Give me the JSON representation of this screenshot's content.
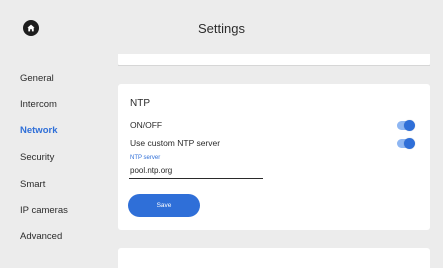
{
  "header": {
    "title": "Settings",
    "home_icon": "home-icon"
  },
  "sidebar": {
    "items": [
      {
        "label": "General"
      },
      {
        "label": "Intercom"
      },
      {
        "label": "Network",
        "active": true
      },
      {
        "label": "Security"
      },
      {
        "label": "Smart"
      },
      {
        "label": "IP cameras"
      },
      {
        "label": "Advanced"
      }
    ]
  },
  "ntp_card": {
    "title": "NTP",
    "onoff_label": "ON/OFF",
    "onoff_state": true,
    "custom_server_label": "Use custom NTP server",
    "custom_server_state": true,
    "server_field_label": "NTP server",
    "server_value": "pool.ntp.org",
    "save_label": "Save"
  },
  "colors": {
    "accent": "#2f6fd8",
    "background": "#ececec",
    "card": "#ffffff"
  }
}
